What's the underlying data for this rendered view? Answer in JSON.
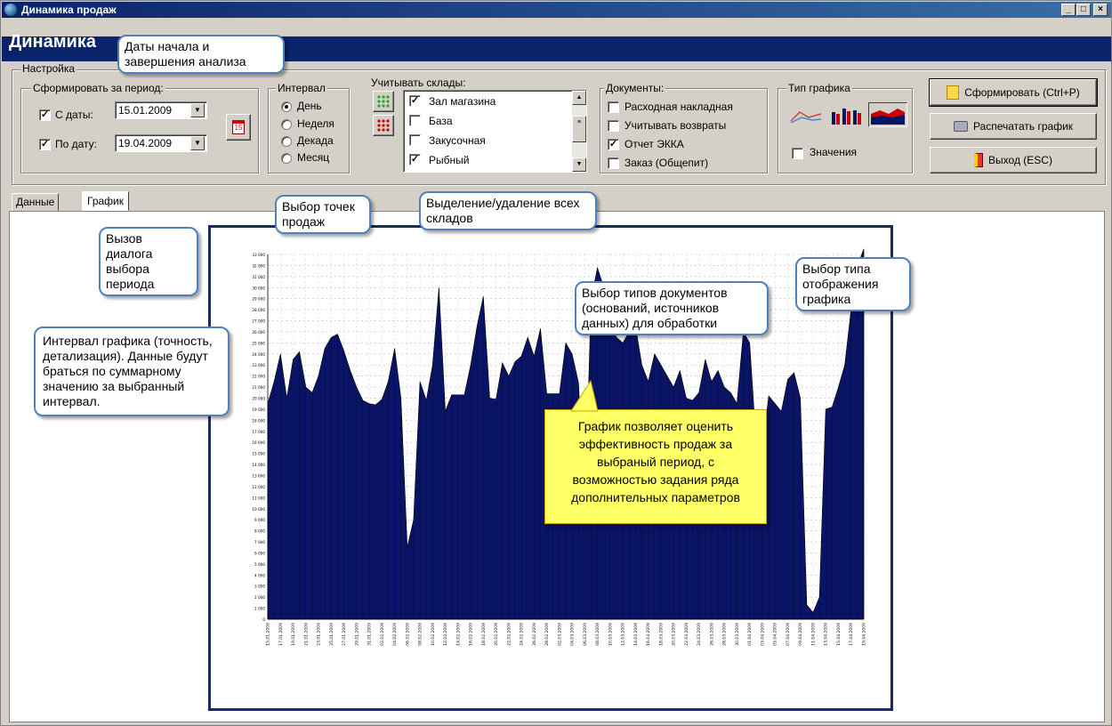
{
  "window": {
    "title": "Динамика продаж"
  },
  "header": {
    "title": "Динамика"
  },
  "settings": {
    "legend": "Настройка"
  },
  "period": {
    "legend": "Сформировать за период:",
    "from_label": "С даты:",
    "from_value": "15.01.2009",
    "from_checked": true,
    "to_label": "По дату:",
    "to_value": "19.04.2009",
    "to_checked": true,
    "calendar_icon": "calendar-15-icon"
  },
  "interval": {
    "legend": "Интервал",
    "options": [
      "День",
      "Неделя",
      "Декада",
      "Месяц"
    ],
    "selected": "День"
  },
  "warehouses": {
    "legend": "Учитывать склады:",
    "items": [
      {
        "label": "Зал магазина",
        "checked": true
      },
      {
        "label": "База",
        "checked": false
      },
      {
        "label": "Закусочная",
        "checked": false
      },
      {
        "label": "Рыбный",
        "checked": true
      }
    ],
    "select_all_icon": "green-dots-icon",
    "deselect_all_icon": "red-dots-icon"
  },
  "documents": {
    "legend": "Документы:",
    "items": [
      {
        "label": "Расходная накладная",
        "checked": false
      },
      {
        "label": "Учитывать возвраты",
        "checked": false
      },
      {
        "label": "Отчет ЭККА",
        "checked": true
      },
      {
        "label": "Заказ (Общепит)",
        "checked": false
      }
    ]
  },
  "chart_type": {
    "legend": "Тип графика",
    "types": [
      "line-chart-icon",
      "bar-chart-icon",
      "area-chart-icon"
    ],
    "selected": "area-chart-icon",
    "values_label": "Значения",
    "values_checked": false
  },
  "actions": {
    "build_label": "Сформировать (Ctrl+P)",
    "print_label": "Распечатать график",
    "exit_label": "Выход (ESC)"
  },
  "tabs": [
    {
      "label": "Данные"
    },
    {
      "label": "График"
    }
  ],
  "active_tab": "График",
  "callouts": {
    "dates": "Даты начала и завершения анализа",
    "calendar": "Вызов диалога выбора периода",
    "interval": "Интервал графика (точность, детализация). Данные будут браться по суммарному значению за выбранный интервал.",
    "points": "Выбор точек продаж",
    "select_all": "Выделение/удаление всех складов",
    "doc_types": "Выбор типов документов (оснований, источников данных) для обработки",
    "chart_type": "Выбор типа отображения графика"
  },
  "note": "График позволяет оценить эффективность продаж за выбраный период, с возможностью задания ряда дополнительных параметров",
  "colors": {
    "title_bar": "#0a246a",
    "area_fill": "#0a1466",
    "callout_border": "#4f81bd",
    "note_bg": "#ffff66"
  },
  "chart_data": {
    "type": "area",
    "ylim": [
      0,
      33000
    ],
    "y_tick_step": 1000,
    "x": [
      "15.01.2009",
      "16.01.2009",
      "17.01.2009",
      "18.01.2009",
      "19.01.2009",
      "20.01.2009",
      "21.01.2009",
      "22.01.2009",
      "23.01.2009",
      "24.01.2009",
      "25.01.2009",
      "26.01.2009",
      "27.01.2009",
      "28.01.2009",
      "29.01.2009",
      "30.01.2009",
      "31.01.2009",
      "01.02.2009",
      "02.02.2009",
      "03.02.2009",
      "04.02.2009",
      "05.02.2009",
      "06.02.2009",
      "07.02.2009",
      "08.02.2009",
      "09.02.2009",
      "10.02.2009",
      "11.02.2009",
      "12.02.2009",
      "13.02.2009",
      "14.02.2009",
      "15.02.2009",
      "16.02.2009",
      "17.02.2009",
      "18.02.2009",
      "19.02.2009",
      "20.02.2009",
      "21.02.2009",
      "22.02.2009",
      "23.02.2009",
      "24.02.2009",
      "25.02.2009",
      "26.02.2009",
      "27.02.2009",
      "28.02.2009",
      "01.03.2009",
      "02.03.2009",
      "03.03.2009",
      "04.03.2009",
      "05.03.2009",
      "06.03.2009",
      "07.03.2009",
      "08.03.2009",
      "09.03.2009",
      "10.03.2009",
      "11.03.2009",
      "12.03.2009",
      "13.03.2009",
      "14.03.2009",
      "15.03.2009",
      "16.03.2009",
      "17.03.2009",
      "18.03.2009",
      "19.03.2009",
      "20.03.2009",
      "21.03.2009",
      "22.03.2009",
      "23.03.2009",
      "24.03.2009",
      "25.03.2009",
      "26.03.2009",
      "27.03.2009",
      "28.03.2009",
      "29.03.2009",
      "30.03.2009",
      "31.03.2009",
      "01.04.2009",
      "02.04.2009",
      "03.04.2009",
      "04.04.2009",
      "05.04.2009",
      "06.04.2009",
      "07.04.2009",
      "08.04.2009",
      "09.04.2009",
      "10.04.2009",
      "11.04.2009",
      "12.04.2009",
      "13.04.2009",
      "14.04.2009",
      "15.04.2009",
      "16.04.2009",
      "17.04.2009",
      "18.04.2009",
      "19.04.2009"
    ],
    "y": [
      19500,
      21500,
      24000,
      20000,
      23500,
      24200,
      21000,
      20500,
      22000,
      24500,
      25500,
      25800,
      24300,
      22500,
      21000,
      19800,
      19500,
      19400,
      19900,
      21500,
      24500,
      20000,
      6500,
      9000,
      21500,
      19800,
      23000,
      30000,
      18800,
      20300,
      20300,
      20300,
      23000,
      26500,
      29200,
      20000,
      19900,
      23200,
      22000,
      23300,
      23800,
      25500,
      23800,
      26300,
      20400,
      20400,
      20400,
      25000,
      24000,
      21400,
      9500,
      29000,
      31800,
      30000,
      27000,
      25500,
      25000,
      26000,
      26500,
      23000,
      21500,
      24000,
      23000,
      22000,
      21000,
      22500,
      20000,
      19800,
      20500,
      23500,
      21500,
      22500,
      21000,
      20500,
      19500,
      26000,
      25000,
      16200,
      15500,
      20200,
      19500,
      18800,
      21700,
      22300,
      20000,
      1300,
      600,
      2000,
      19000,
      19200,
      21000,
      23000,
      28000,
      32000,
      33500
    ]
  }
}
